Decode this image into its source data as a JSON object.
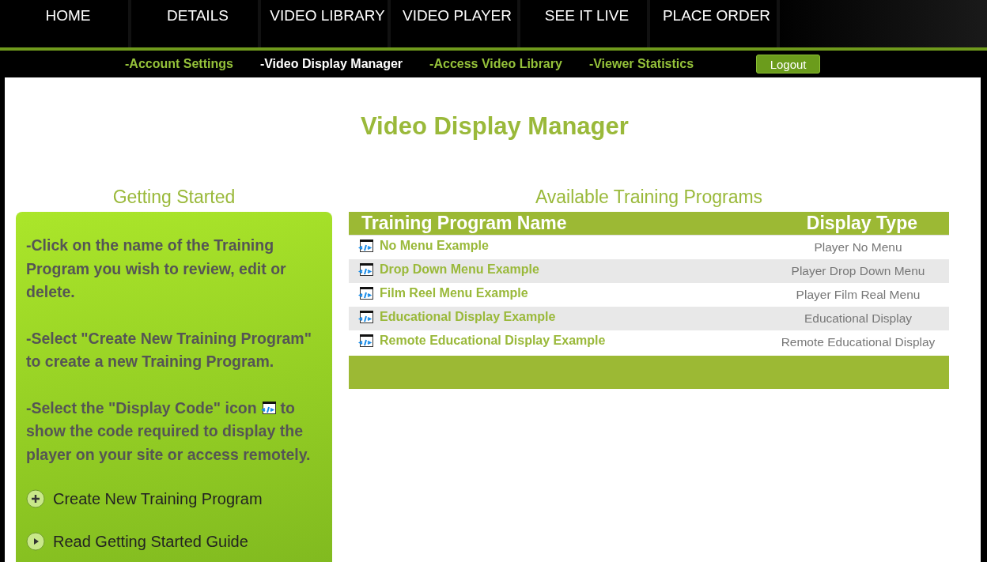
{
  "main_nav": [
    {
      "label": "HOME",
      "selected": false
    },
    {
      "label": "DETAILS",
      "selected": false
    },
    {
      "label": "VIDEO LIBRARY",
      "selected": false
    },
    {
      "label": "VIDEO PLAYER",
      "selected": false
    },
    {
      "label": "SEE IT LIVE",
      "selected": false
    },
    {
      "label": "PLACE ORDER",
      "selected": false
    }
  ],
  "sub_nav": [
    {
      "label": "-Account Settings",
      "selected": false
    },
    {
      "label": "-Video Display Manager",
      "selected": true
    },
    {
      "label": "-Access Video Library",
      "selected": false
    },
    {
      "label": "-Viewer Statistics",
      "selected": false
    }
  ],
  "logout_button": "Logout",
  "page_title": "Video Display Manager",
  "getting_started": {
    "title": "Getting Started",
    "instructions": [
      {
        "text": "-Click on the name of the Training Program you wish to review, edit or delete."
      },
      {
        "text": "-Select \"Create New Training Program\" to create a new Training Program."
      },
      {
        "text": "-Select the \"Display Code\" icon",
        "after_icon": "to",
        "continued": "show the code required to display the player on your site or access remotely."
      }
    ],
    "links": [
      {
        "kind": "add",
        "label": "Create New Training Program"
      },
      {
        "kind": "play",
        "label": "Read Getting Started Guide"
      }
    ]
  },
  "programs": {
    "title": "Available Training Programs",
    "columns": [
      "Training Program Name",
      "Display Type"
    ],
    "rows": [
      {
        "name": "No Menu Example",
        "display_type": "Player No Menu"
      },
      {
        "name": "Drop Down Menu Example",
        "display_type": "Player Drop Down Menu"
      },
      {
        "name": "Film Reel Menu Example",
        "display_type": "Player Film Real Menu"
      },
      {
        "name": "Educational Display Example",
        "display_type": "Educational Display"
      },
      {
        "name": "Remote Educational Display Example",
        "display_type": "Remote Educational Display"
      }
    ]
  }
}
